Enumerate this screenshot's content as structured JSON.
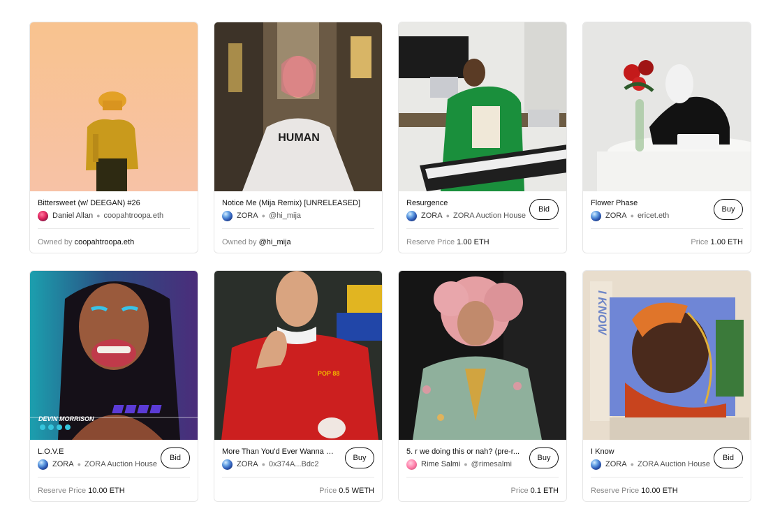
{
  "cards": [
    {
      "title": "Bittersweet (w/ DEEGAN) #26",
      "avatar": "daniel-avatar",
      "creator": "Daniel Allan",
      "sub": "coopahtroopa.eth",
      "action": "",
      "footer_label": "Owned by",
      "footer_value": "coopahtroopa.eth"
    },
    {
      "title": "Notice Me (Mija Remix) [UNRELEASED]",
      "avatar": "zora-avatar",
      "creator": "ZORA",
      "sub": "@hi_mija",
      "action": "",
      "footer_label": "Owned by",
      "footer_value": "@hi_mija",
      "shirt_text": "HUMAN"
    },
    {
      "title": "Resurgence",
      "avatar": "zora-avatar",
      "creator": "ZORA",
      "sub": "ZORA Auction House",
      "action": "Bid",
      "footer_label": "Reserve Price",
      "footer_value": "1.00 ETH"
    },
    {
      "title": "Flower Phase",
      "avatar": "zora-avatar",
      "creator": "ZORA",
      "sub": "ericet.eth",
      "action": "Buy",
      "footer_label": "Price",
      "footer_value": "1.00 ETH"
    },
    {
      "title": "L.O.V.E",
      "avatar": "zora-avatar",
      "creator": "ZORA",
      "sub": "ZORA Auction House",
      "action": "Bid",
      "footer_label": "Reserve Price",
      "footer_value": "10.00 ETH",
      "art_text": "DEVIN MORRISON"
    },
    {
      "title": "More Than You'd Ever Wanna K...",
      "avatar": "zora-avatar",
      "creator": "ZORA",
      "sub": "0x374A...Bdc2",
      "action": "Buy",
      "footer_label": "Price",
      "footer_value": "0.5 WETH",
      "shirt_text": "POP 88"
    },
    {
      "title": "5. r we doing this or nah? (pre-r...",
      "avatar": "rime-avatar",
      "creator": "Rime Salmi",
      "sub": "@rimesalmi",
      "action": "Buy",
      "footer_label": "Price",
      "footer_value": "0.1 ETH"
    },
    {
      "title": "I Know",
      "avatar": "zora-avatar",
      "creator": "ZORA",
      "sub": "ZORA Auction House",
      "action": "Bid",
      "footer_label": "Reserve Price",
      "footer_value": "10.00 ETH",
      "art_text": "I KNOW"
    }
  ]
}
